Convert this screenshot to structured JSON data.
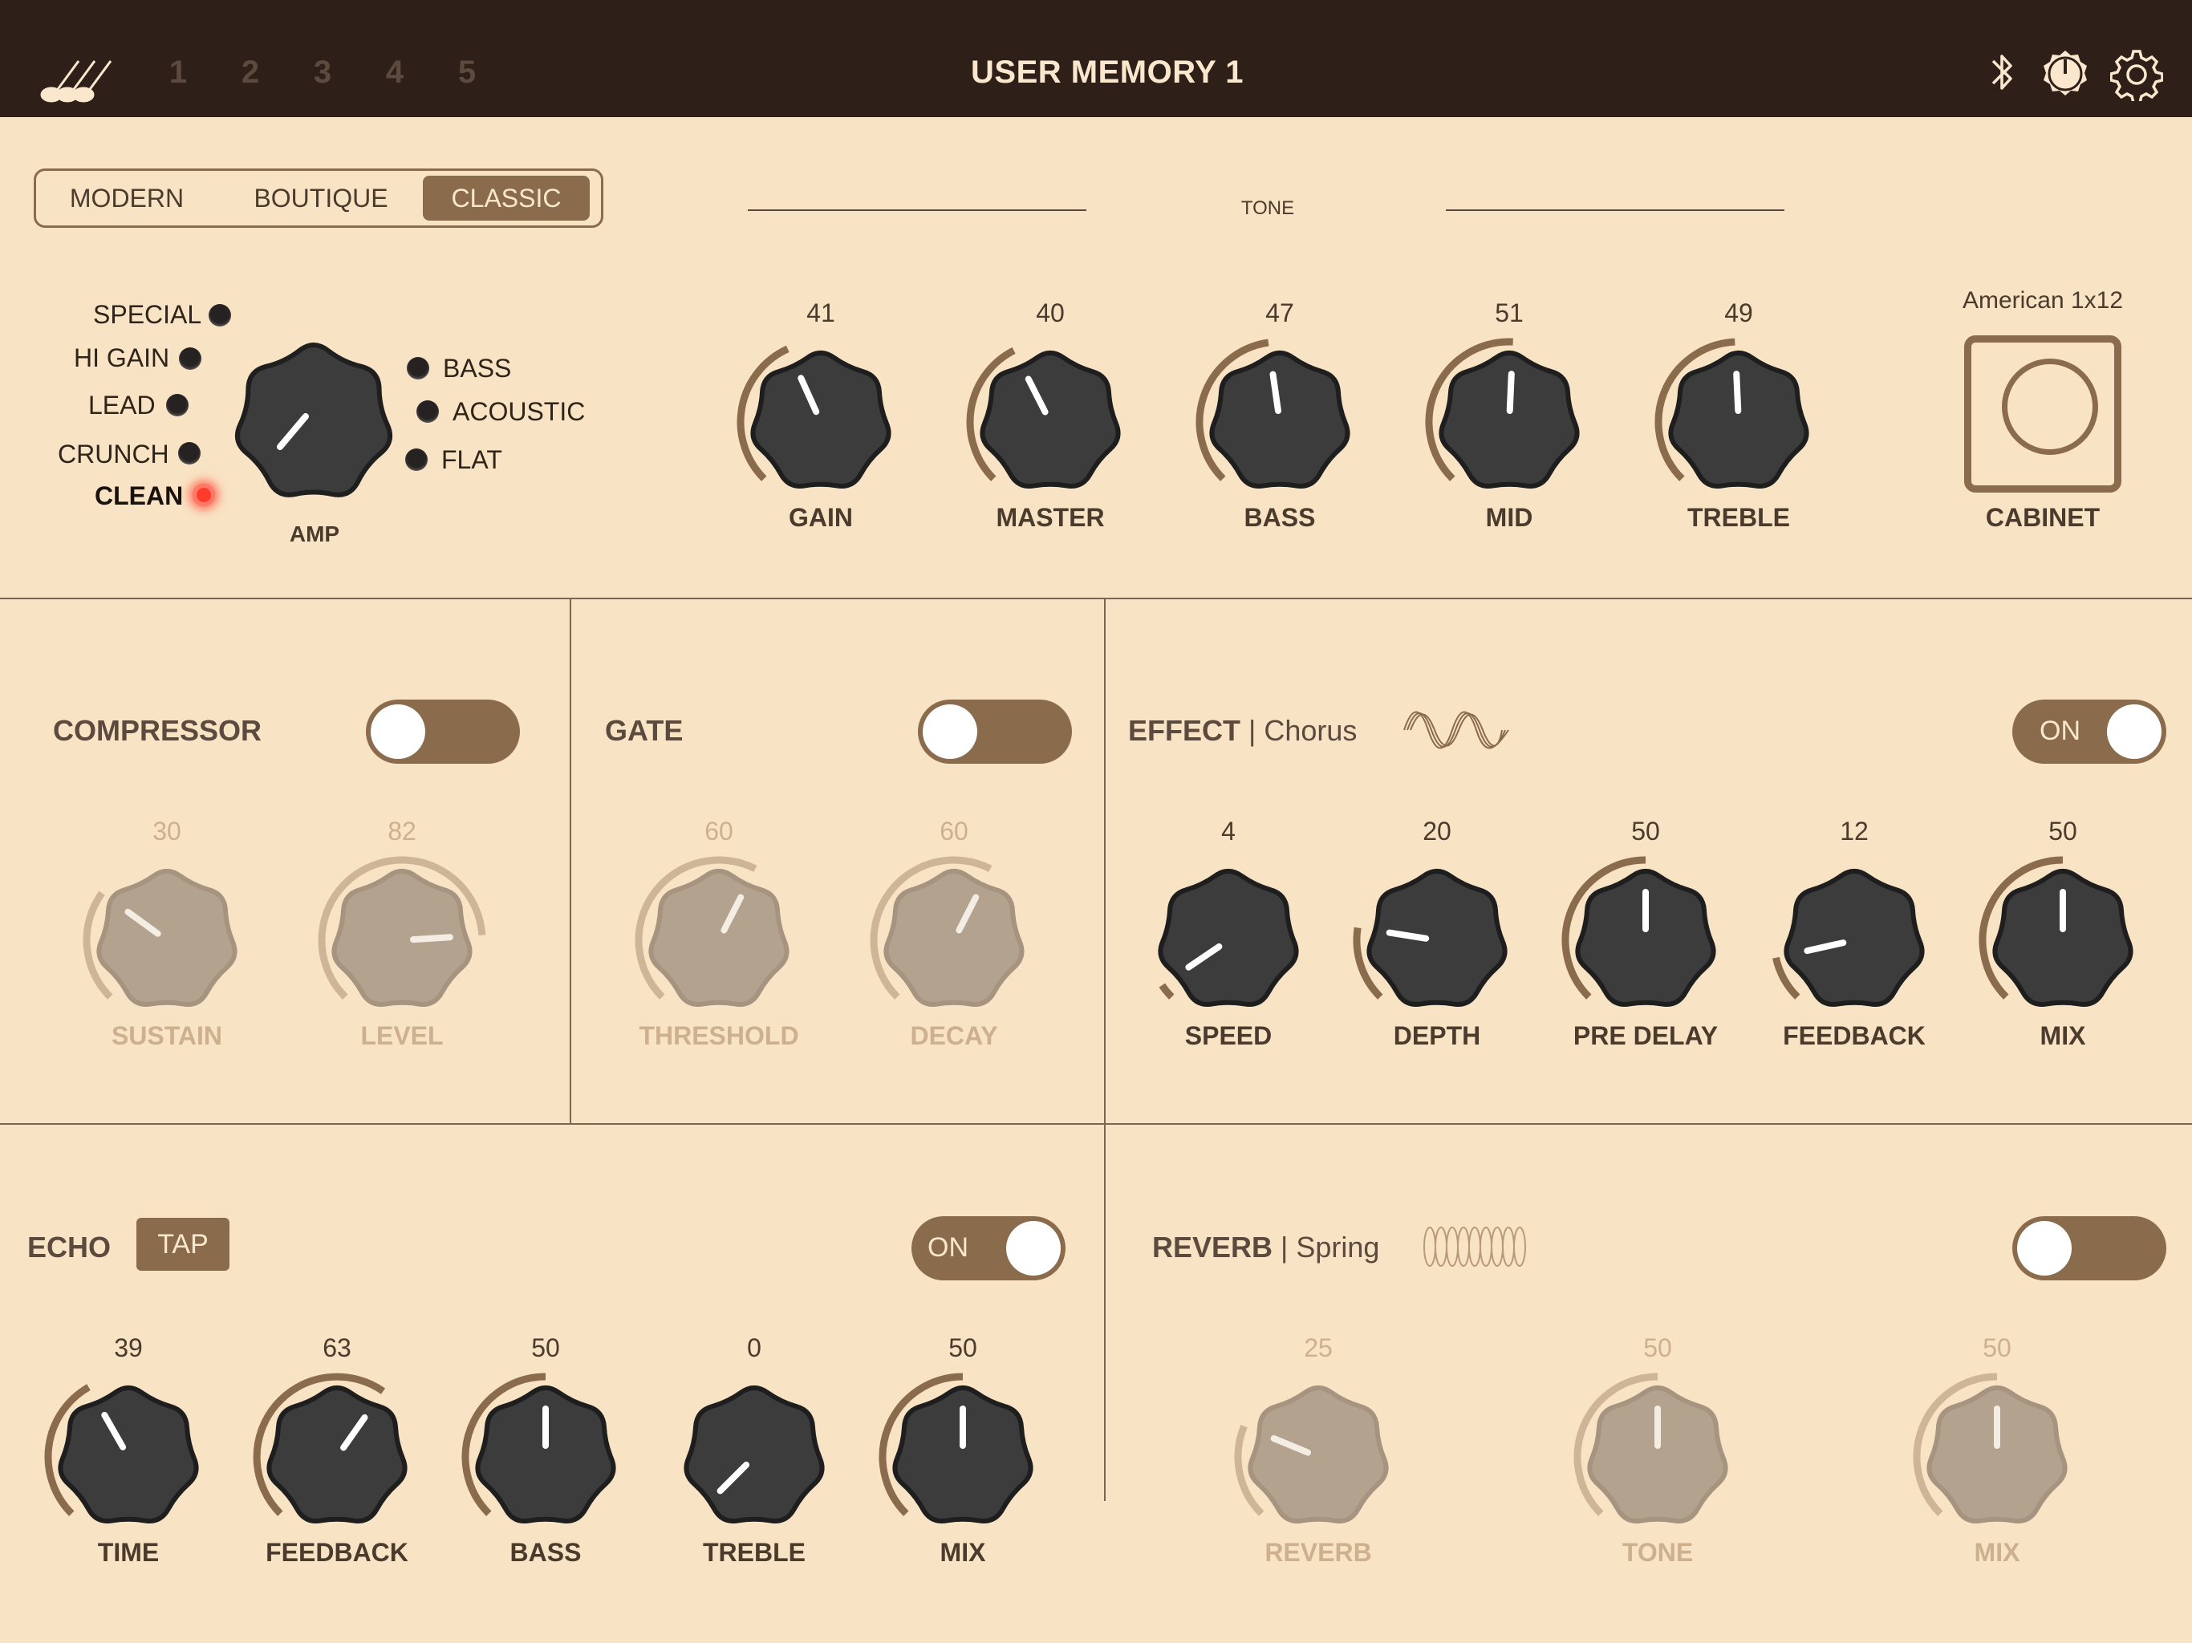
{
  "top_bar": {
    "memory_slots": [
      "1",
      "2",
      "3",
      "4",
      "5"
    ],
    "title": "USER MEMORY 1"
  },
  "amp_section": {
    "model_tabs": [
      "MODERN",
      "BOUTIQUE",
      "CLASSIC"
    ],
    "active_tab": "CLASSIC",
    "tone_header": "TONE",
    "amp_knob_label": "AMP",
    "amp_types_left": [
      "SPECIAL",
      "HI GAIN",
      "LEAD",
      "CRUNCH",
      "CLEAN"
    ],
    "amp_types_right": [
      "BASS",
      "ACOUSTIC",
      "FLAT"
    ],
    "selected_amp_type": "CLEAN",
    "tone_knobs": [
      {
        "label": "GAIN",
        "value": "41"
      },
      {
        "label": "MASTER",
        "value": "40"
      },
      {
        "label": "BASS",
        "value": "47"
      },
      {
        "label": "MID",
        "value": "51"
      },
      {
        "label": "TREBLE",
        "value": "49"
      }
    ],
    "cabinet": {
      "name": "American 1x12",
      "label": "CABINET"
    }
  },
  "compressor": {
    "title": "COMPRESSOR",
    "enabled": false,
    "knobs": [
      {
        "label": "SUSTAIN",
        "value": "30"
      },
      {
        "label": "LEVEL",
        "value": "82"
      }
    ]
  },
  "gate": {
    "title": "GATE",
    "enabled": false,
    "knobs": [
      {
        "label": "THRESHOLD",
        "value": "60"
      },
      {
        "label": "DECAY",
        "value": "60"
      }
    ]
  },
  "effect": {
    "title": "EFFECT",
    "type": "Chorus",
    "toggle_label": "ON",
    "enabled": true,
    "knobs": [
      {
        "label": "SPEED",
        "value": "4"
      },
      {
        "label": "DEPTH",
        "value": "20"
      },
      {
        "label": "PRE DELAY",
        "value": "50"
      },
      {
        "label": "FEEDBACK",
        "value": "12"
      },
      {
        "label": "MIX",
        "value": "50"
      }
    ]
  },
  "echo": {
    "title": "ECHO",
    "tap_label": "TAP",
    "toggle_label": "ON",
    "enabled": true,
    "knobs": [
      {
        "label": "TIME",
        "value": "39"
      },
      {
        "label": "FEEDBACK",
        "value": "63"
      },
      {
        "label": "BASS",
        "value": "50"
      },
      {
        "label": "TREBLE",
        "value": "0"
      },
      {
        "label": "MIX",
        "value": "50"
      }
    ]
  },
  "reverb": {
    "title": "REVERB",
    "type": "Spring",
    "enabled": false,
    "knobs": [
      {
        "label": "REVERB",
        "value": "25"
      },
      {
        "label": "TONE",
        "value": "50"
      },
      {
        "label": "MIX",
        "value": "50"
      }
    ]
  },
  "colors": {
    "accent": "#8a6c4c",
    "background": "#f9e3c5",
    "topbar": "#2e2019",
    "led_on": "#ff3b2a"
  }
}
